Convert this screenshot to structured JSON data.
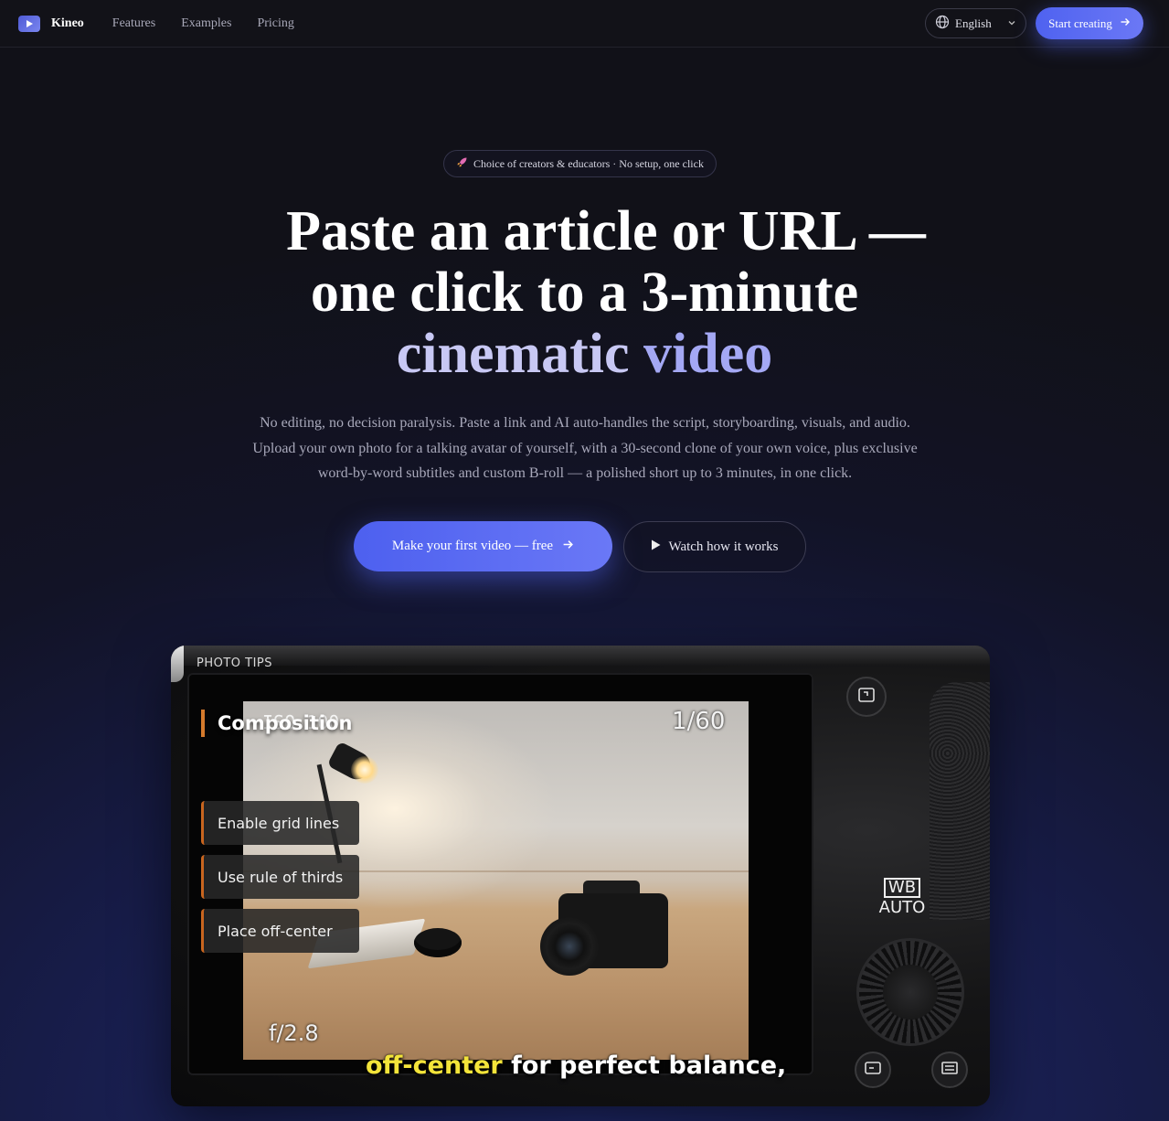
{
  "nav": {
    "brand": "Kineo",
    "links": [
      "Features",
      "Examples",
      "Pricing"
    ],
    "language": "English",
    "cta": "Start creating"
  },
  "hero": {
    "badge_icon": "rocket-icon",
    "badge": "Choice of creators & educators · No setup, one click",
    "headline_line1": "Paste an article or URL —",
    "headline_line2": "one click to a 3-minute",
    "headline_accent_a": "cinematic",
    "headline_accent_b": "video",
    "subtext": "No editing, no decision paralysis. Paste a link and AI auto-handles the script, storyboarding, visuals, and audio. Upload your own photo for a talking avatar of yourself, with a 30-second clone of your own voice, plus exclusive word-by-word subtitles and custom B-roll — a polished short up to 3 minutes, in one click.",
    "primary_cta": "Make your first video — free",
    "secondary_cta": "Watch how it works"
  },
  "preview": {
    "category": "PHOTO TIPS",
    "title": "Composition",
    "iso": "ISO 100",
    "shutter": "1/60",
    "aperture": "f/2.8",
    "tips": [
      "Enable grid lines",
      "Use rule of thirds",
      "Place off-center"
    ],
    "caption_highlight": "off-center",
    "caption_rest": "for perfect balance,",
    "wb_top": "WB",
    "wb_bottom": "AUTO"
  },
  "colors": {
    "accent": "#5b6bf2",
    "accent_text": "#a4a8f4",
    "tip_border": "#c8651f",
    "caption_highlight": "#f3e43a"
  }
}
